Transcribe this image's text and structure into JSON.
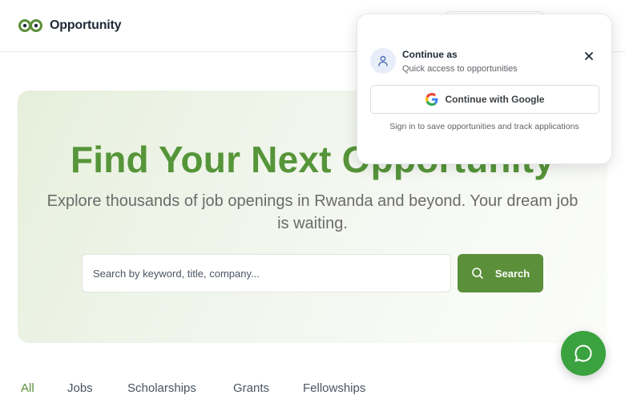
{
  "brand": {
    "name": "Opportunity",
    "accent": "#5b8f3a"
  },
  "hero": {
    "title": "Find Your Next Opportunity",
    "subtitle": "Explore thousands of job openings in Rwanda and beyond. Your dream job is waiting."
  },
  "search": {
    "placeholder": "Search by keyword, title, company...",
    "value": "",
    "button_label": "Search",
    "icon": "search-icon"
  },
  "tabs": [
    {
      "label": "All",
      "active": true
    },
    {
      "label": "Jobs",
      "active": false
    },
    {
      "label": "Scholarships",
      "active": false
    },
    {
      "label": "Grants",
      "active": false
    },
    {
      "label": "Fellowships",
      "active": false
    }
  ],
  "signin_popup": {
    "title": "Continue as",
    "subtitle": "Quick access to opportunities",
    "google_button": "Continue with Google",
    "footer": "Sign in to save opportunities and track applications",
    "icons": [
      "user-icon",
      "close-icon",
      "google-icon"
    ]
  },
  "chat": {
    "icon": "chat-bubble-icon",
    "color": "#3aa23e"
  }
}
